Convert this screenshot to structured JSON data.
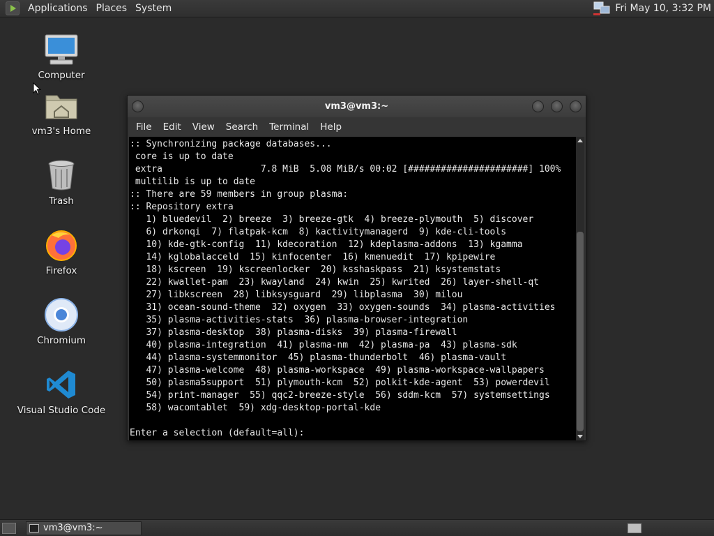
{
  "top_panel": {
    "menu": [
      "Applications",
      "Places",
      "System"
    ],
    "clock": "Fri May 10,  3:32 PM"
  },
  "desktop_icons": [
    {
      "label": "Computer",
      "icon": "computer-icon"
    },
    {
      "label": "vm3's Home",
      "icon": "home-folder-icon"
    },
    {
      "label": "Trash",
      "icon": "trash-icon"
    },
    {
      "label": "Firefox",
      "icon": "firefox-icon"
    },
    {
      "label": "Chromium",
      "icon": "chromium-icon"
    },
    {
      "label": "Visual Studio Code",
      "icon": "vscode-icon"
    }
  ],
  "terminal": {
    "title": "vm3@vm3:~",
    "menu": [
      "File",
      "Edit",
      "View",
      "Search",
      "Terminal",
      "Help"
    ],
    "lines": [
      ":: Synchronizing package databases...",
      " core is up to date",
      " extra                  7.8 MiB  5.08 MiB/s 00:02 [######################] 100%",
      " multilib is up to date",
      ":: There are 59 members in group plasma:",
      ":: Repository extra",
      "   1) bluedevil  2) breeze  3) breeze-gtk  4) breeze-plymouth  5) discover",
      "   6) drkonqi  7) flatpak-kcm  8) kactivitymanagerd  9) kde-cli-tools",
      "   10) kde-gtk-config  11) kdecoration  12) kdeplasma-addons  13) kgamma",
      "   14) kglobalacceld  15) kinfocenter  16) kmenuedit  17) kpipewire",
      "   18) kscreen  19) kscreenlocker  20) ksshaskpass  21) ksystemstats",
      "   22) kwallet-pam  23) kwayland  24) kwin  25) kwrited  26) layer-shell-qt",
      "   27) libkscreen  28) libksysguard  29) libplasma  30) milou",
      "   31) ocean-sound-theme  32) oxygen  33) oxygen-sounds  34) plasma-activities",
      "   35) plasma-activities-stats  36) plasma-browser-integration",
      "   37) plasma-desktop  38) plasma-disks  39) plasma-firewall",
      "   40) plasma-integration  41) plasma-nm  42) plasma-pa  43) plasma-sdk",
      "   44) plasma-systemmonitor  45) plasma-thunderbolt  46) plasma-vault",
      "   47) plasma-welcome  48) plasma-workspace  49) plasma-workspace-wallpapers",
      "   50) plasma5support  51) plymouth-kcm  52) polkit-kde-agent  53) powerdevil",
      "   54) print-manager  55) qqc2-breeze-style  56) sddm-kcm  57) systemsettings",
      "   58) wacomtablet  59) xdg-desktop-portal-kde",
      "",
      "Enter a selection (default=all): "
    ]
  },
  "taskbar": {
    "task_label": "vm3@vm3:~"
  }
}
